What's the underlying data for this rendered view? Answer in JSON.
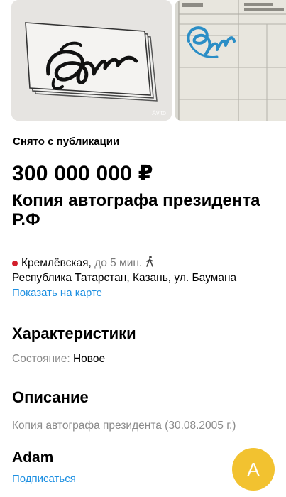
{
  "gallery": {
    "photos": [
      {
        "name": "autograph-photo-card",
        "watermark": "Avito"
      },
      {
        "name": "autograph-photo-document"
      }
    ]
  },
  "listing": {
    "status": "Снято с публикации",
    "price": "300 000 000 ₽",
    "title": "Копия автографа президента Р.Ф"
  },
  "location": {
    "metro_station": "Кремлёвская,",
    "metro_time": "до 5 мин.",
    "metro_color": "#d21e2b",
    "address": "Республика Татарстан, Казань, ул. Баумана",
    "map_link": "Показать на карте"
  },
  "characteristics": {
    "heading": "Характеристики",
    "condition_label": "Состояние:",
    "condition_value": "Новое"
  },
  "description": {
    "heading": "Описание",
    "text": "Копия автографа президента (30.08.2005 г.)"
  },
  "seller": {
    "name": "Adam",
    "subscribe": "Подписаться",
    "avatar_letter": "A",
    "avatar_color": "#f2c230"
  },
  "colors": {
    "link": "#1d8fe1",
    "secondary_text": "#8a8a8a"
  }
}
